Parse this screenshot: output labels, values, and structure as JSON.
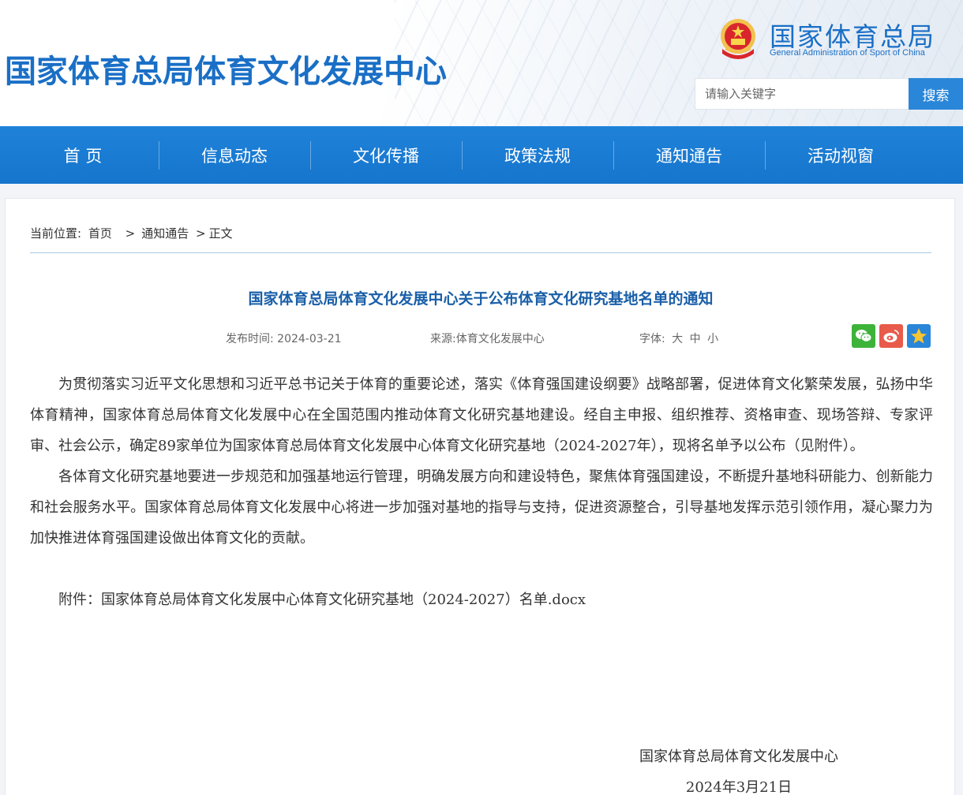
{
  "header": {
    "site_title": "国家体育总局体育文化发展中心",
    "gov_name": "国家体育总局",
    "gov_name_en": "General Administration of Sport of China",
    "search_placeholder": "请输入关键字",
    "search_button": "搜索"
  },
  "nav": {
    "items": [
      "首 页",
      "信息动态",
      "文化传播",
      "政策法规",
      "通知通告",
      "活动视窗"
    ]
  },
  "breadcrumb": {
    "prefix": "当前位置:",
    "items": [
      "首页",
      "通知通告",
      "正文"
    ],
    "separator": ">"
  },
  "article": {
    "title": "国家体育总局体育文化发展中心关于公布体育文化研究基地名单的通知",
    "publish_label": "发布时间:",
    "publish_date": "2024-03-21",
    "source_label": "来源:",
    "source": "体育文化发展中心",
    "font_label": "字体:",
    "font_sizes": [
      "大",
      "中",
      "小"
    ],
    "paragraphs": [
      "为贯彻落实习近平文化思想和习近平总书记关于体育的重要论述，落实《体育强国建设纲要》战略部署，促进体育文化繁荣发展，弘扬中华体育精神，国家体育总局体育文化发展中心在全国范围内推动体育文化研究基地建设。经自主申报、组织推荐、资格审查、现场答辩、专家评审、社会公示，确定89家单位为国家体育总局体育文化发展中心体育文化研究基地（2024-2027年），现将名单予以公布（见附件）。",
      "各体育文化研究基地要进一步规范和加强基地运行管理，明确发展方向和建设特色，聚焦体育强国建设，不断提升基地科研能力、创新能力和社会服务水平。国家体育总局体育文化发展中心将进一步加强对基地的指导与支持，促进资源整合，引导基地发挥示范引领作用，凝心聚力为加快推进体育强国建设做出体育文化的贡献。"
    ],
    "attachment_label": "附件：",
    "attachment_name": "国家体育总局体育文化发展中心体育文化研究基地（2024-2027）名单.docx",
    "signature_org": "国家体育总局体育文化发展中心",
    "signature_date": "2024年3月21日"
  },
  "colors": {
    "brand_blue": "#1a6fc6",
    "nav_blue": "#1f82d9",
    "title_blue": "#1a5fa8"
  },
  "icons": [
    "national-emblem-icon",
    "wechat-icon",
    "weibo-icon",
    "favorite-star-icon"
  ]
}
